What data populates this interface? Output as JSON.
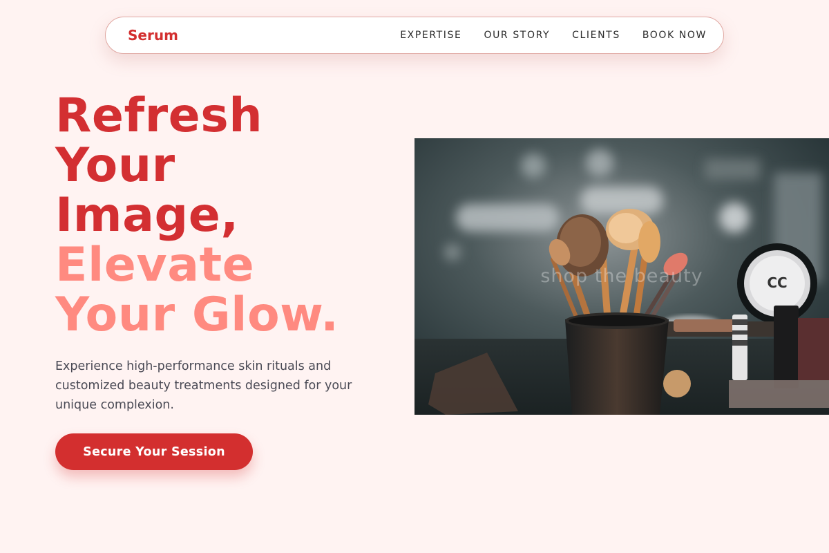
{
  "nav": {
    "brand": "Serum",
    "links": [
      "EXPERTISE",
      "OUR STORY",
      "CLIENTS",
      "BOOK NOW"
    ]
  },
  "hero": {
    "title_lines": [
      "Refresh",
      "Your",
      "Image,",
      "Elevate",
      "Your Glow."
    ],
    "description": "Experience high-performance skin rituals and customized beauty treatments designed for your unique complexion.",
    "cta_label": "Secure Your Session",
    "image": {
      "subject": "makeup brushes in a holder on a vanity",
      "watermark": "shop the beauty"
    }
  },
  "colors": {
    "background": "#fff3f2",
    "brand_red": "#d32f2f",
    "accent_coral": "#ff8a80",
    "text_dark": "#2b2b2b",
    "text_muted": "#4a4a55"
  }
}
